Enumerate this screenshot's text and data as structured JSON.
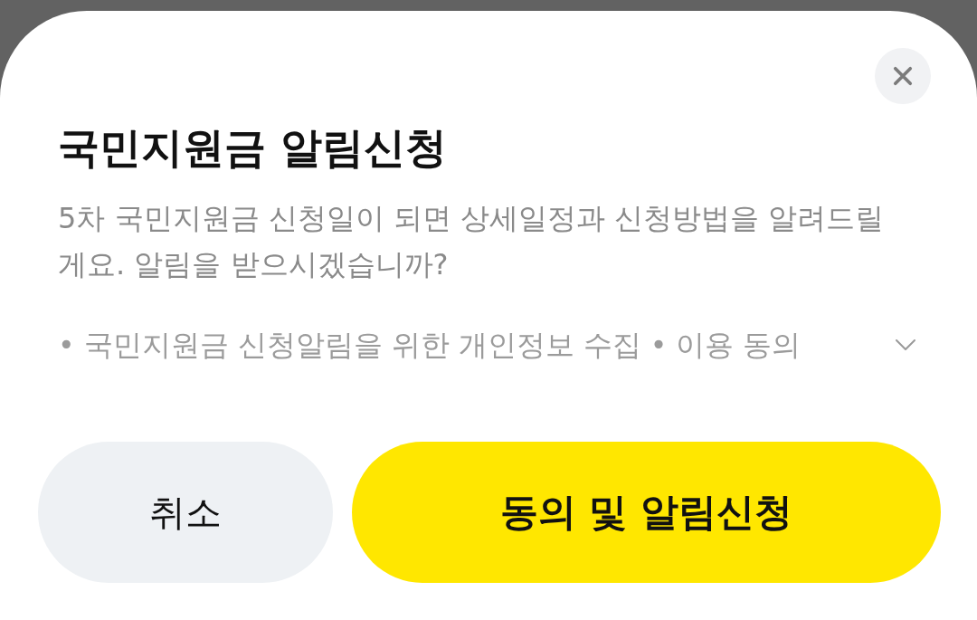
{
  "dialog": {
    "title": "국민지원금 알림신청",
    "description": "5차 국민지원금 신청일이 되면 상세일정과 신청방법을 알려드릴게요. 알림을 받으시겠습니까?",
    "consent": {
      "label": "• 국민지원금 신청알림을 위한 개인정보 수집 • 이용 동의",
      "expanded": false
    },
    "buttons": [
      {
        "label": "취소",
        "kind": "secondary"
      },
      {
        "label": "동의 및 알림신청",
        "kind": "primary"
      }
    ]
  }
}
